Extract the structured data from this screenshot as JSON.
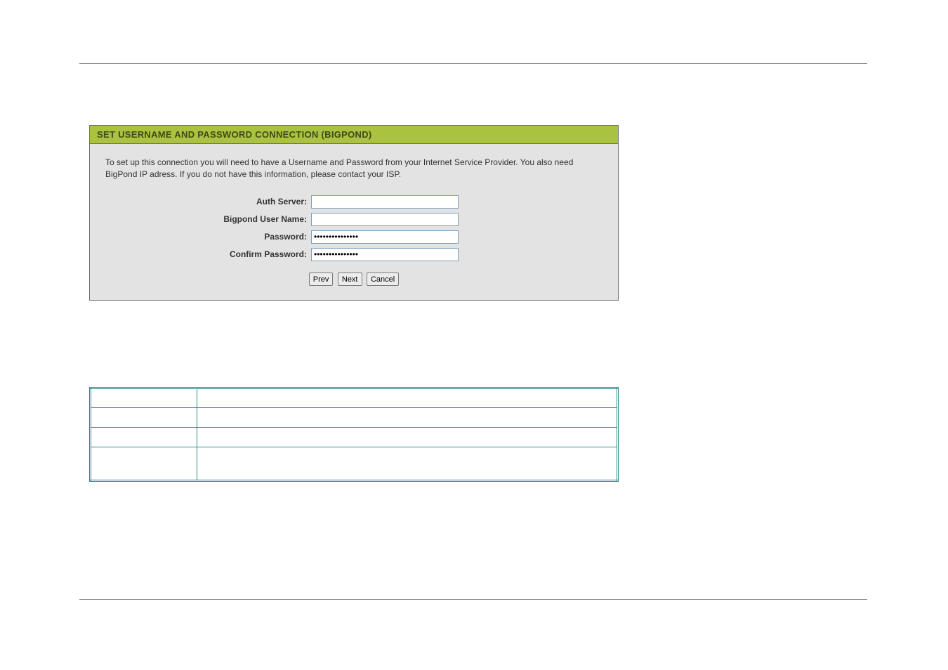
{
  "panel": {
    "title": "SET USERNAME AND PASSWORD CONNECTION (BIGPOND)",
    "description": "To set up this connection you will need to have a Username and Password from your Internet Service Provider. You also need BigPond IP adress. If you do not have this information, please contact your ISP.",
    "fields": {
      "auth_server": {
        "label": "Auth Server:",
        "value": ""
      },
      "bigpond_user_name": {
        "label": "Bigpond User Name:",
        "value": ""
      },
      "password": {
        "label": "Password:",
        "value": "•••••••••••••••"
      },
      "confirm_password": {
        "label": "Confirm Password:",
        "value": "•••••••••••••••"
      }
    },
    "buttons": {
      "prev": "Prev",
      "next": "Next",
      "cancel": "Cancel"
    }
  },
  "info_table": {
    "rows": [
      {
        "left": "",
        "right": ""
      },
      {
        "left": "",
        "right": ""
      },
      {
        "left": "",
        "right": ""
      },
      {
        "left": "",
        "right": ""
      }
    ]
  }
}
